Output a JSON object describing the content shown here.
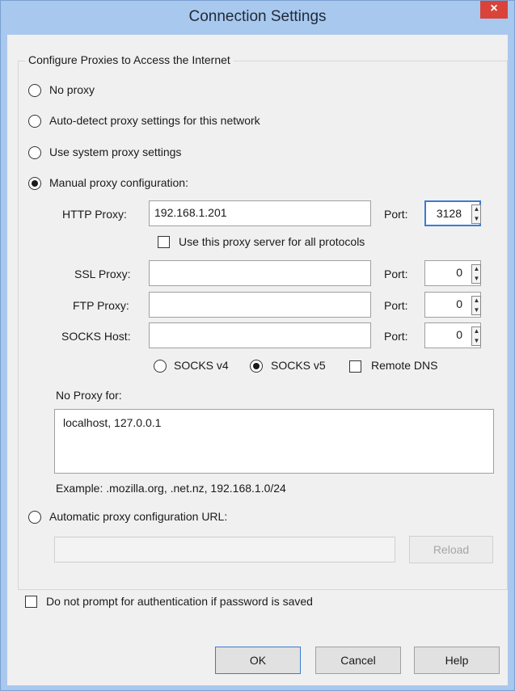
{
  "window": {
    "title": "Connection Settings",
    "close_glyph": "×"
  },
  "group": {
    "legend": "Configure Proxies to Access the Internet"
  },
  "proxy_modes": {
    "no_proxy": "No proxy",
    "auto_detect": "Auto-detect proxy settings for this network",
    "system": "Use system proxy settings",
    "manual": "Manual proxy configuration:",
    "selected": "manual"
  },
  "http": {
    "label": "HTTP Proxy:",
    "value": "192.168.1.201",
    "port_label": "Port:",
    "port": "3128"
  },
  "share": {
    "label": "Use this proxy server for all protocols",
    "checked": false
  },
  "ssl": {
    "label": "SSL Proxy:",
    "value": "",
    "port_label": "Port:",
    "port": "0"
  },
  "ftp": {
    "label": "FTP Proxy:",
    "value": "",
    "port_label": "Port:",
    "port": "0"
  },
  "socks": {
    "label": "SOCKS Host:",
    "value": "",
    "port_label": "Port:",
    "port": "0",
    "v4_label": "SOCKS v4",
    "v5_label": "SOCKS v5",
    "selected": "v5",
    "remote_dns_label": "Remote DNS",
    "remote_dns_checked": false
  },
  "no_proxy_for": {
    "label": "No Proxy for:",
    "value": "localhost, 127.0.0.1",
    "example": "Example: .mozilla.org, .net.nz, 192.168.1.0/24"
  },
  "auto_config": {
    "label": "Automatic proxy configuration URL:",
    "value": "",
    "reload_label": "Reload"
  },
  "auth": {
    "label": "Do not prompt for authentication if password is saved",
    "checked": false
  },
  "buttons": {
    "ok": "OK",
    "cancel": "Cancel",
    "help": "Help"
  }
}
